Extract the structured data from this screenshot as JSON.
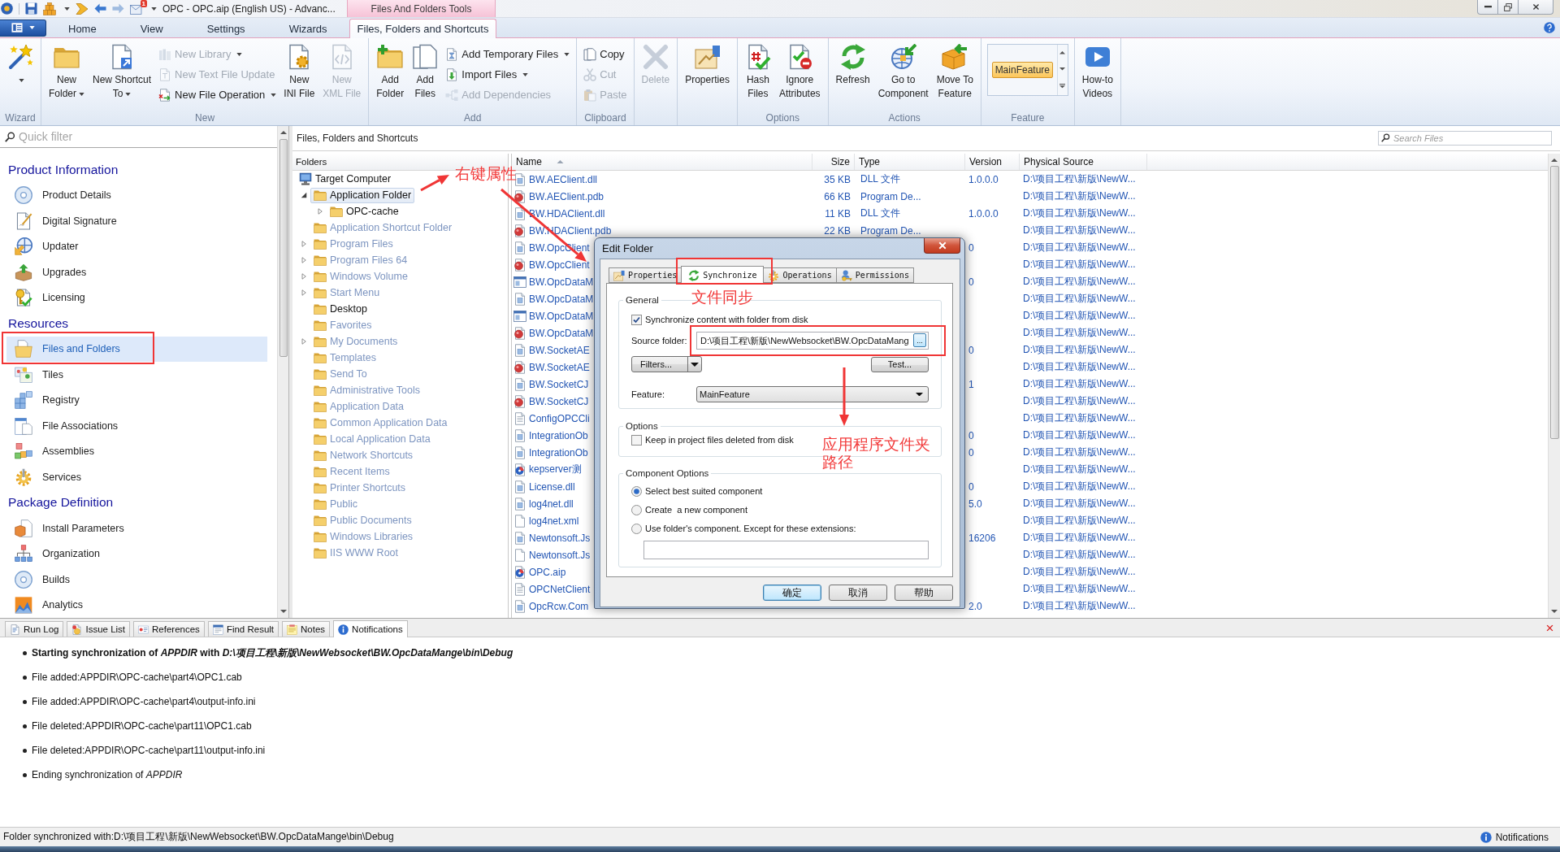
{
  "title_bar": {
    "badge": "1",
    "title": "OPC - OPC.aip (English US) - Advanc...",
    "context_tab_group": "Files And Folders Tools"
  },
  "ribbon": {
    "tabs": [
      {
        "label": "Home",
        "selected": false
      },
      {
        "label": "View",
        "selected": false
      },
      {
        "label": "Settings",
        "selected": false
      },
      {
        "label": "Wizards",
        "selected": false
      },
      {
        "label": "Files, Folders and Shortcuts",
        "selected": true
      }
    ],
    "groups": [
      {
        "label": "Wizard",
        "controls": [
          {
            "kind": "large",
            "dropdown": true,
            "disabled": false
          }
        ]
      },
      {
        "label": "New",
        "controls": [
          {
            "kind": "large",
            "label": "New\nFolder",
            "dropdown": true,
            "disabled": false
          },
          {
            "kind": "large",
            "label": "New Shortcut\nTo",
            "dropdown": true,
            "disabled": false
          },
          {
            "kind": "stack",
            "items": [
              {
                "label": "New Library",
                "dropdown": true,
                "disabled": true
              },
              {
                "label": "New Text File Update",
                "dropdown": false,
                "disabled": true
              },
              {
                "label": "New File Operation",
                "dropdown": true,
                "disabled": false
              }
            ]
          },
          {
            "kind": "large",
            "label": "New\nINI File",
            "dropdown": false,
            "disabled": false
          },
          {
            "kind": "large",
            "label": "New\nXML File",
            "dropdown": false,
            "disabled": true
          }
        ]
      },
      {
        "label": "Add",
        "controls": [
          {
            "kind": "large",
            "label": "Add\nFolder",
            "dropdown": false,
            "disabled": false
          },
          {
            "kind": "large",
            "label": "Add\nFiles",
            "dropdown": false,
            "disabled": false
          },
          {
            "kind": "stack",
            "items": [
              {
                "label": "Add Temporary Files",
                "dropdown": true,
                "disabled": false
              },
              {
                "label": "Import Files",
                "dropdown": true,
                "disabled": false
              },
              {
                "label": "Add Dependencies",
                "dropdown": false,
                "disabled": true
              }
            ]
          }
        ]
      },
      {
        "label": "Clipboard",
        "controls": [
          {
            "kind": "stack",
            "items": [
              {
                "label": "Copy",
                "dropdown": false,
                "disabled": false
              },
              {
                "label": "Cut",
                "dropdown": false,
                "disabled": true
              },
              {
                "label": "Paste",
                "dropdown": false,
                "disabled": true
              }
            ]
          }
        ]
      },
      {
        "controls": [
          {
            "kind": "large",
            "label": "Delete",
            "dropdown": false,
            "disabled": true
          }
        ]
      },
      {
        "controls": [
          {
            "kind": "large",
            "label": "Properties",
            "dropdown": false,
            "disabled": false
          }
        ]
      },
      {
        "label": "Options",
        "controls": [
          {
            "kind": "large",
            "label": "Hash\nFiles",
            "dropdown": false,
            "disabled": false
          },
          {
            "kind": "large",
            "label": "Ignore\nAttributes",
            "dropdown": false,
            "disabled": false
          }
        ]
      },
      {
        "label": "Actions",
        "controls": [
          {
            "kind": "large",
            "label": "Refresh",
            "dropdown": false,
            "disabled": false
          },
          {
            "kind": "large",
            "label": "Go to\nComponent",
            "dropdown": false,
            "disabled": false
          },
          {
            "kind": "large",
            "label": "Move To\nFeature",
            "dropdown": false,
            "disabled": false
          }
        ]
      },
      {
        "label": "Feature",
        "controls": [
          {
            "kind": "gallery",
            "items": [
              {
                "label": "MainFeature",
                "selected": true
              }
            ]
          }
        ]
      },
      {
        "controls": [
          {
            "kind": "large",
            "label": "How-to\nVideos",
            "dropdown": false,
            "disabled": false
          }
        ]
      }
    ]
  },
  "sidebar": {
    "filter": {
      "placeholder": "Quick filter"
    },
    "sections": [
      {
        "title": "Product Information",
        "items": [
          {
            "label": "Product Details",
            "selected": false
          },
          {
            "label": "Digital Signature",
            "selected": false
          },
          {
            "label": "Updater",
            "selected": false
          },
          {
            "label": "Upgrades",
            "selected": false
          },
          {
            "label": "Licensing",
            "selected": false
          }
        ]
      },
      {
        "title": "Resources",
        "items": [
          {
            "label": "Files and Folders",
            "selected": true
          },
          {
            "label": "Tiles",
            "selected": false
          },
          {
            "label": "Registry",
            "selected": false
          },
          {
            "label": "File Associations",
            "selected": false
          },
          {
            "label": "Assemblies",
            "selected": false
          },
          {
            "label": "Services",
            "selected": false
          }
        ]
      },
      {
        "title": "Package Definition",
        "items": [
          {
            "label": "Install Parameters",
            "selected": false
          },
          {
            "label": "Organization",
            "selected": false
          },
          {
            "label": "Builds",
            "selected": false
          },
          {
            "label": "Analytics",
            "selected": false
          }
        ]
      }
    ]
  },
  "content": {
    "title": "Files, Folders and Shortcuts",
    "search": {
      "placeholder": "Search Files"
    }
  },
  "folders": {
    "header": "Folders",
    "tree": [
      {
        "label": "Target Computer",
        "selected": false,
        "dimmed": false,
        "children": [
          {
            "label": "Application Folder",
            "expanded": true,
            "selected": true,
            "dimmed": false,
            "children": [
              {
                "label": "OPC-cache",
                "expanded": false,
                "selected": false,
                "dimmed": false
              }
            ]
          },
          {
            "label": "Application Shortcut Folder",
            "selected": false,
            "dimmed": true
          },
          {
            "label": "Program Files",
            "expanded": false,
            "selected": false,
            "dimmed": true
          },
          {
            "label": "Program Files 64",
            "expanded": false,
            "selected": false,
            "dimmed": true
          },
          {
            "label": "Windows Volume",
            "expanded": false,
            "selected": false,
            "dimmed": true
          },
          {
            "label": "Start Menu",
            "expanded": false,
            "selected": false,
            "dimmed": true
          },
          {
            "label": "Desktop",
            "selected": false,
            "dimmed": false
          },
          {
            "label": "Favorites",
            "selected": false,
            "dimmed": true
          },
          {
            "label": "My Documents",
            "expanded": false,
            "selected": false,
            "dimmed": true
          },
          {
            "label": "Templates",
            "selected": false,
            "dimmed": true
          },
          {
            "label": "Send To",
            "selected": false,
            "dimmed": true
          },
          {
            "label": "Administrative Tools",
            "selected": false,
            "dimmed": true
          },
          {
            "label": "Application Data",
            "selected": false,
            "dimmed": true
          },
          {
            "label": "Common Application Data",
            "selected": false,
            "dimmed": true
          },
          {
            "label": "Local Application Data",
            "selected": false,
            "dimmed": true
          },
          {
            "label": "Network Shortcuts",
            "selected": false,
            "dimmed": true
          },
          {
            "label": "Recent Items",
            "selected": false,
            "dimmed": true
          },
          {
            "label": "Printer Shortcuts",
            "selected": false,
            "dimmed": true
          },
          {
            "label": "Public",
            "selected": false,
            "dimmed": true
          },
          {
            "label": "Public Documents",
            "selected": false,
            "dimmed": true
          },
          {
            "label": "Windows Libraries",
            "selected": false,
            "dimmed": true
          },
          {
            "label": "IIS WWW Root",
            "selected": false,
            "dimmed": true
          }
        ]
      }
    ]
  },
  "files": {
    "columns": [
      {
        "label": "Name",
        "sorted": true
      },
      {
        "label": "Size",
        "sorted": false
      },
      {
        "label": "Type",
        "sorted": false
      },
      {
        "label": "Version",
        "sorted": false
      },
      {
        "label": "Physical Source",
        "sorted": false
      }
    ],
    "rows": [
      {
        "name": "BW.AEClient.dll",
        "size": "35 KB",
        "type": "DLL 文件",
        "version": "1.0.0.0",
        "source": "D:\\项目工程\\新版\\NewW..."
      },
      {
        "name": "BW.AEClient.pdb",
        "size": "66 KB",
        "type": "Program De...",
        "source": "D:\\项目工程\\新版\\NewW..."
      },
      {
        "name": "BW.HDAClient.dll",
        "size": "11 KB",
        "type": "DLL 文件",
        "version": "1.0.0.0",
        "source": "D:\\项目工程\\新版\\NewW..."
      },
      {
        "name": "BW.HDAClient.pdb",
        "size": "22 KB",
        "type": "Program De...",
        "source": "D:\\项目工程\\新版\\NewW..."
      },
      {
        "name": "BW.OpcClient",
        "version": "0",
        "source": "D:\\项目工程\\新版\\NewW..."
      },
      {
        "name": "BW.OpcClient",
        "source": "D:\\项目工程\\新版\\NewW..."
      },
      {
        "name": "BW.OpcDataM",
        "version": "0",
        "source": "D:\\项目工程\\新版\\NewW..."
      },
      {
        "name": "BW.OpcDataM",
        "source": "D:\\项目工程\\新版\\NewW..."
      },
      {
        "name": "BW.OpcDataM",
        "source": "D:\\项目工程\\新版\\NewW..."
      },
      {
        "name": "BW.OpcDataM",
        "source": "D:\\项目工程\\新版\\NewW..."
      },
      {
        "name": "BW.SocketAE",
        "version": "0",
        "source": "D:\\项目工程\\新版\\NewW..."
      },
      {
        "name": "BW.SocketAE",
        "source": "D:\\项目工程\\新版\\NewW..."
      },
      {
        "name": "BW.SocketCJ",
        "version": "1",
        "source": "D:\\项目工程\\新版\\NewW..."
      },
      {
        "name": "BW.SocketCJ",
        "source": "D:\\项目工程\\新版\\NewW..."
      },
      {
        "name": "ConfigOPCCli",
        "source": "D:\\项目工程\\新版\\NewW..."
      },
      {
        "name": "IntegrationOb",
        "version": "0",
        "source": "D:\\项目工程\\新版\\NewW..."
      },
      {
        "name": "IntegrationOb",
        "version": "0",
        "source": "D:\\项目工程\\新版\\NewW..."
      },
      {
        "name": "kepserver测",
        "source": "D:\\项目工程\\新版\\NewW..."
      },
      {
        "name": "License.dll",
        "version": "0",
        "source": "D:\\项目工程\\新版\\NewW..."
      },
      {
        "name": "log4net.dll",
        "version": "5.0",
        "source": "D:\\项目工程\\新版\\NewW..."
      },
      {
        "name": "log4net.xml",
        "source": "D:\\项目工程\\新版\\NewW..."
      },
      {
        "name": "Newtonsoft.Js",
        "version": "16206",
        "source": "D:\\项目工程\\新版\\NewW..."
      },
      {
        "name": "Newtonsoft.Js",
        "source": "D:\\项目工程\\新版\\NewW..."
      },
      {
        "name": "OPC.aip",
        "source": "D:\\项目工程\\新版\\NewW..."
      },
      {
        "name": "OPCNetClient",
        "source": "D:\\项目工程\\新版\\NewW..."
      },
      {
        "name": "OpcRcw.Com",
        "version": "2.0",
        "source": "D:\\项目工程\\新版\\NewW..."
      }
    ]
  },
  "dialog": {
    "title": "Edit Folder",
    "tabs": [
      {
        "label": "Properties",
        "selected": false
      },
      {
        "label": "Synchronize",
        "selected": true
      },
      {
        "label": "Operations",
        "selected": false
      },
      {
        "label": "Permissions",
        "selected": false
      }
    ],
    "general": {
      "title": "General",
      "sync_checkbox": {
        "label": "Synchronize content with folder from disk",
        "checked": true
      },
      "source_label": "Source folder:",
      "source_value": "D:\\项目工程\\新版\\NewWebsocket\\BW.OpcDataMang",
      "browse_button": "...",
      "filters_button": "Filters...",
      "test_button": "Test...",
      "feature_label": "Feature:",
      "feature_value": "MainFeature"
    },
    "options": {
      "title": "Options",
      "keep_checkbox": {
        "label": "Keep in project files deleted from disk",
        "checked": false
      }
    },
    "component_options": {
      "title": "Component Options",
      "radios": [
        {
          "label": "Select best suited component",
          "selected": true
        },
        {
          "label": "Create  a new component",
          "selected": false
        },
        {
          "label": "Use folder's component. Except for these extensions:",
          "selected": false
        }
      ]
    },
    "buttons": [
      {
        "label": "确定",
        "default": true
      },
      {
        "label": "取消",
        "default": false
      },
      {
        "label": "帮助",
        "default": false
      }
    ]
  },
  "bottom_panel": {
    "tabs": [
      {
        "label": "Run Log",
        "selected": false
      },
      {
        "label": "Issue List",
        "selected": false
      },
      {
        "label": "References",
        "selected": false
      },
      {
        "label": "Find Result",
        "selected": false
      },
      {
        "label": "Notes",
        "selected": false
      },
      {
        "label": "Notifications",
        "selected": true
      }
    ],
    "messages": [
      {
        "text": "Starting synchronization of *APPDIR* with *D:\\项目工程\\新版\\NewWebsocket\\BW.OpcDataMange\\bin\\Debug*",
        "bold": true
      },
      {
        "text": "File added:APPDIR\\OPC-cache\\part4\\OPC1.cab",
        "bold": false
      },
      {
        "text": "File added:APPDIR\\OPC-cache\\part4\\output-info.ini",
        "bold": false
      },
      {
        "text": "File deleted:APPDIR\\OPC-cache\\part11\\OPC1.cab",
        "bold": false
      },
      {
        "text": "File deleted:APPDIR\\OPC-cache\\part11\\output-info.ini",
        "bold": false
      },
      {
        "text": "Ending synchronization of *APPDIR*",
        "bold": false
      }
    ]
  },
  "status_bar": {
    "message": "Folder synchronized with:D:\\项目工程\\新版\\NewWebsocket\\BW.OpcDataMange\\bin\\Debug",
    "notifications": "Notifications"
  },
  "annotations": [
    {
      "text": "右键属性"
    },
    {
      "text": "文件同步"
    },
    {
      "text": "应用程序文件夹路径"
    }
  ]
}
